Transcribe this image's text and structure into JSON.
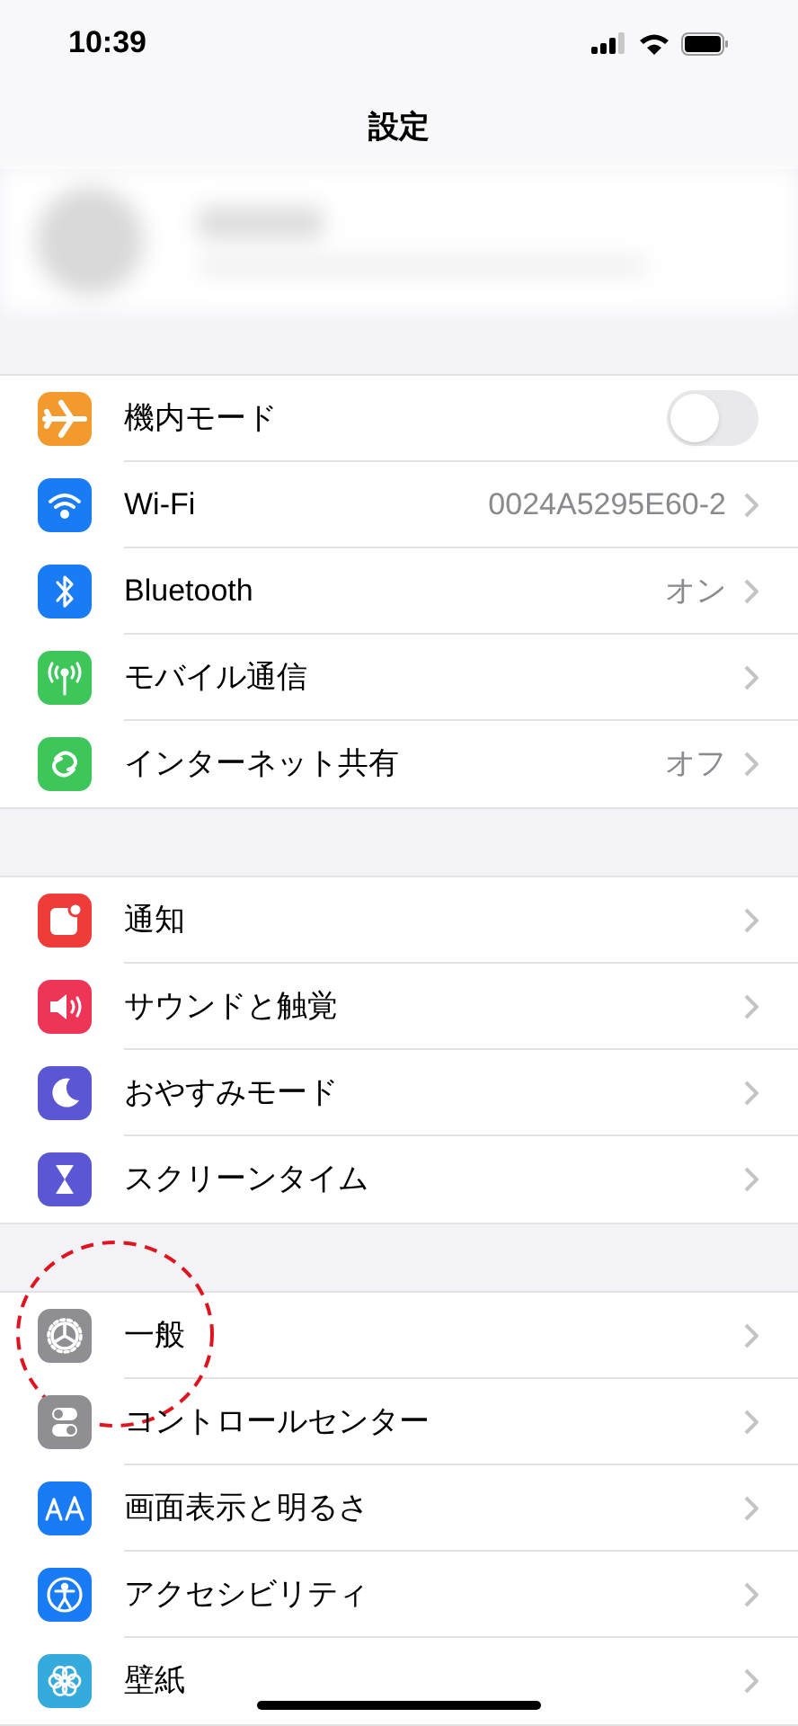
{
  "status_bar": {
    "time": "10:39"
  },
  "nav": {
    "title": "設定"
  },
  "groups": [
    {
      "rows": [
        {
          "kind": "toggle",
          "color": "#f39a2f",
          "label": "機内モード",
          "on": false
        },
        {
          "kind": "link",
          "color": "#1a7cf5",
          "label": "Wi-Fi",
          "value": "0024A5295E60-2"
        },
        {
          "kind": "link",
          "color": "#1a7cf5",
          "label": "Bluetooth",
          "value": "オン"
        },
        {
          "kind": "link",
          "color": "#3ec65b",
          "label": "モバイル通信"
        },
        {
          "kind": "link",
          "color": "#3ec65b",
          "label": "インターネット共有",
          "value": "オフ"
        }
      ]
    },
    {
      "rows": [
        {
          "kind": "link",
          "color": "#ef3b3a",
          "label": "通知"
        },
        {
          "kind": "link",
          "color": "#ee3557",
          "label": "サウンドと触覚"
        },
        {
          "kind": "link",
          "color": "#5b56d3",
          "label": "おやすみモード"
        },
        {
          "kind": "link",
          "color": "#5b56d3",
          "label": "スクリーンタイム"
        }
      ]
    },
    {
      "rows": [
        {
          "kind": "link",
          "color": "#8e8e93",
          "label": "一般",
          "highlighted": true
        },
        {
          "kind": "link",
          "color": "#8e8e93",
          "label": "コントロールセンター"
        },
        {
          "kind": "link",
          "color": "#1a7cf5",
          "label": "画面表示と明るさ"
        },
        {
          "kind": "link",
          "color": "#1a7cf5",
          "label": "アクセシビリティ"
        },
        {
          "kind": "link",
          "color": "#35aadc",
          "label": "壁紙"
        }
      ]
    }
  ]
}
